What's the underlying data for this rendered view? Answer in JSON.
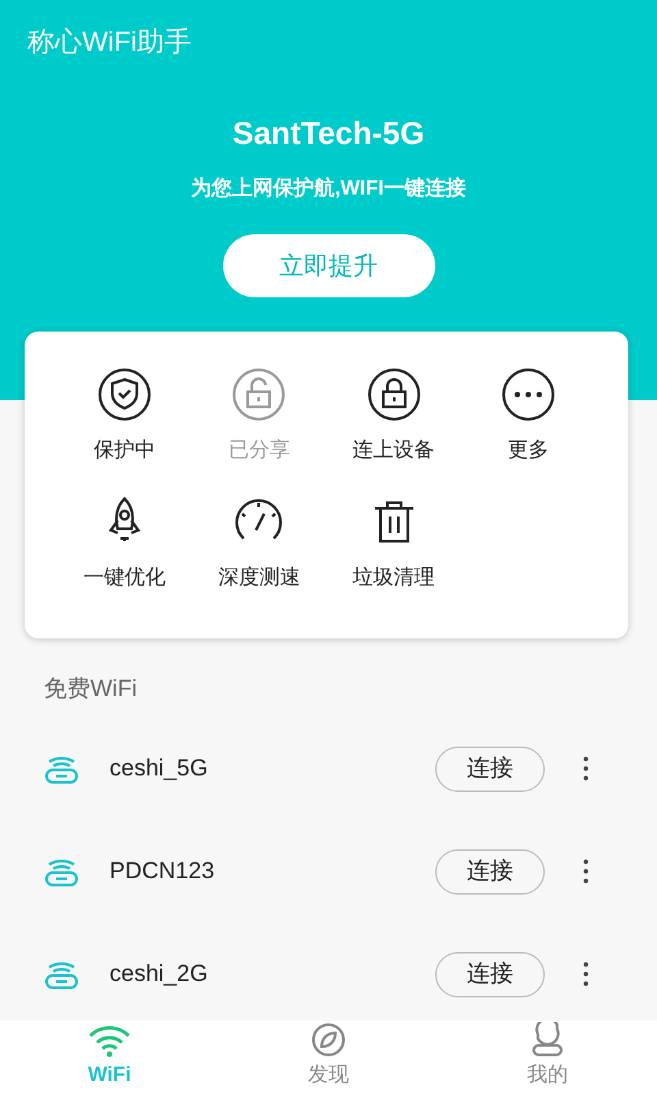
{
  "header": {
    "app_title": "称心WiFi助手",
    "network_name": "SantTech-5G",
    "slogan": "为您上网保护航,WIFI一键连接",
    "upgrade_button": "立即提升"
  },
  "tools": [
    {
      "kind": "shield",
      "label": "保护中",
      "disabled": false
    },
    {
      "kind": "unlock",
      "label": "已分享",
      "disabled": true
    },
    {
      "kind": "lock",
      "label": "连上设备",
      "disabled": false
    },
    {
      "kind": "more",
      "label": "更多",
      "disabled": false
    },
    {
      "kind": "rocket",
      "label": "一键优化",
      "disabled": false
    },
    {
      "kind": "gauge",
      "label": "深度测速",
      "disabled": false
    },
    {
      "kind": "trash",
      "label": "垃圾清理",
      "disabled": false
    }
  ],
  "section_title": "免费WiFi",
  "networks": [
    {
      "name": "ceshi_5G",
      "button": "连接"
    },
    {
      "name": "PDCN123",
      "button": "连接"
    },
    {
      "name": "ceshi_2G",
      "button": "连接"
    }
  ],
  "tabs": [
    {
      "kind": "wifi",
      "label": "WiFi",
      "selected": true
    },
    {
      "kind": "discover",
      "label": "发现",
      "selected": false
    },
    {
      "kind": "me",
      "label": "我的",
      "selected": false
    }
  ]
}
